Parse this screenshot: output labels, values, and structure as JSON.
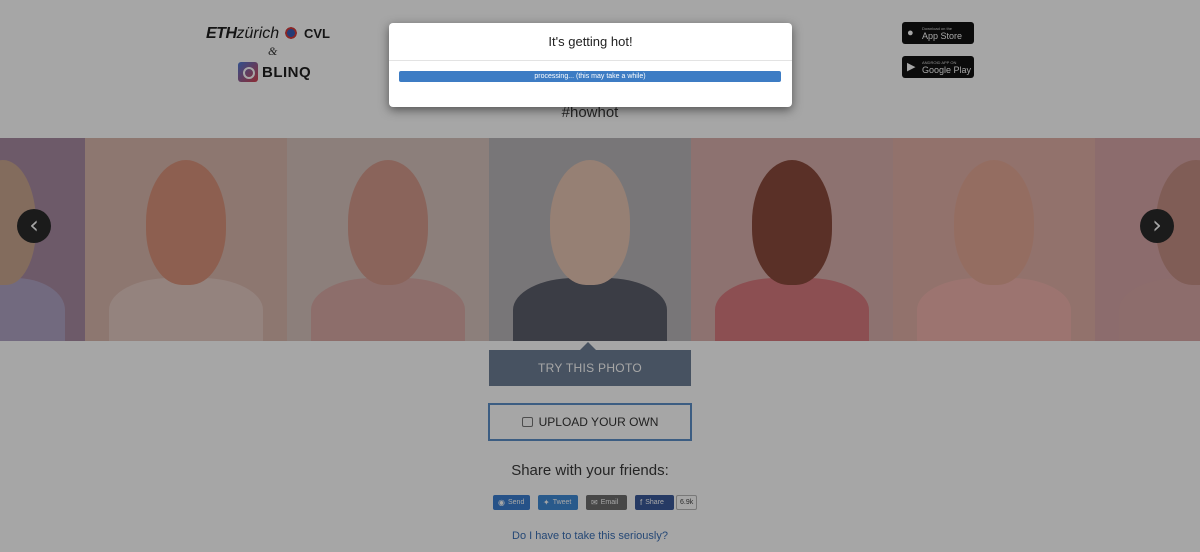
{
  "header": {
    "eth_bold": "ETH",
    "eth_rest": "zürich",
    "cvl": "CVL",
    "ampersand": "&",
    "blinq": "BLINQ",
    "appstore_small": "Download on the",
    "appstore_big": "App Store",
    "googleplay_small": "ANDROID APP ON",
    "googleplay_big": "Google Play"
  },
  "hashtag": "#howhot",
  "carousel": {
    "photos": [
      {
        "name": "photo-1",
        "skin": "#c9a78f",
        "bg": "#a88aa2",
        "shirt": "#b0a4c4"
      },
      {
        "name": "photo-2",
        "skin": "#d9937c",
        "bg": "#d9b7ad",
        "shirt": "#e4c9c2"
      },
      {
        "name": "photo-3",
        "skin": "#d49a8c",
        "bg": "#d8c3bd",
        "shirt": "#d9a9a5"
      },
      {
        "name": "photo-4",
        "skin": "#e6c5b3",
        "bg": "#b9b6b8",
        "shirt": "#5b5e6a"
      },
      {
        "name": "photo-5",
        "skin": "#8a4b3c",
        "bg": "#d9b0ad",
        "shirt": "#d87a7f"
      },
      {
        "name": "photo-6",
        "skin": "#e4a896",
        "bg": "#e1b0a6",
        "shirt": "#f0b3ad"
      },
      {
        "name": "photo-7",
        "skin": "#c58f85",
        "bg": "#d8a7a8",
        "shirt": "#d9a8a7"
      }
    ]
  },
  "try_button": "TRY THIS PHOTO",
  "upload_button": "UPLOAD YOUR OWN",
  "share": {
    "title": "Share with your friends:",
    "send": "Send",
    "tweet": "Tweet",
    "email": "Email",
    "share": "Share",
    "count": "6.9k"
  },
  "serious_link": "Do I have to take this seriously?",
  "modal": {
    "title": "It's getting hot!",
    "progress_text": "processing... (this may take a while)",
    "progress_fraction": 1.0
  }
}
